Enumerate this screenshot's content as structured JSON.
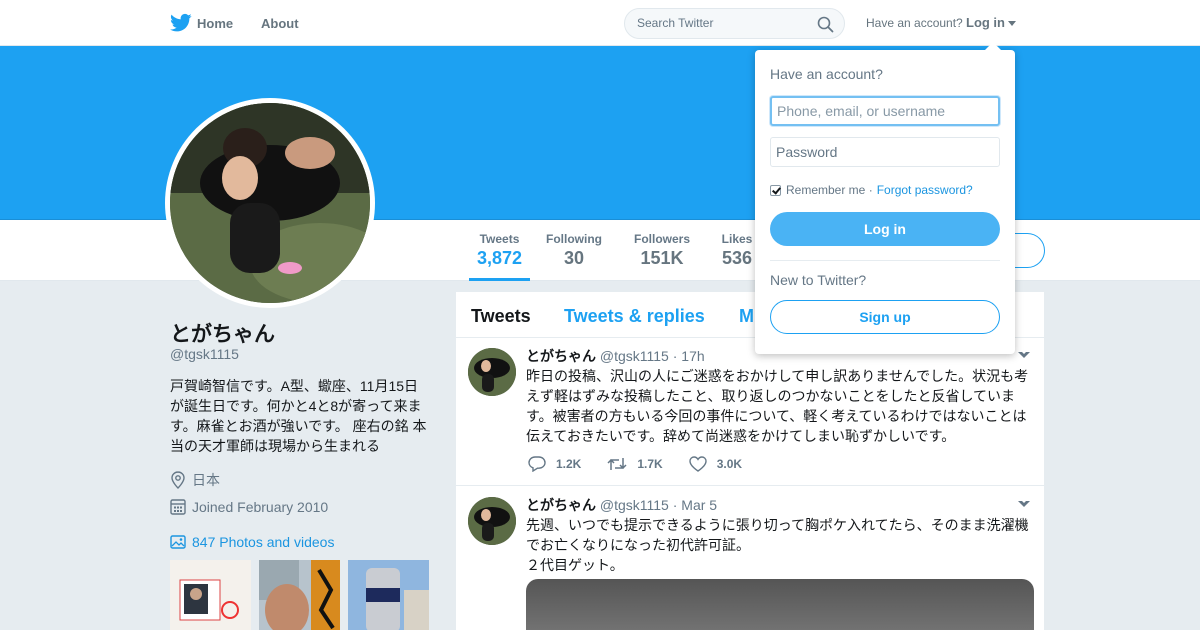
{
  "nav": {
    "home_label": "Home",
    "about_label": "About",
    "search_placeholder": "Search Twitter",
    "have_account": "Have an account?",
    "login_label": "Log in",
    "brand_color": "#1da1f2"
  },
  "stats": [
    {
      "label": "Tweets",
      "value": "3,872"
    },
    {
      "label": "Following",
      "value": "30"
    },
    {
      "label": "Followers",
      "value": "151K"
    },
    {
      "label": "Likes",
      "value": "536"
    }
  ],
  "profile": {
    "name": "とがちゃん",
    "handle": "@tgsk1115",
    "bio": "戸賀崎智信です。A型、蠍座、11月15日が誕生日です。何かと4と8が寄って来ます。麻雀とお酒が強いです。 座右の銘 本当の天才軍師は現場から生まれる",
    "location": "日本",
    "joined": "Joined February 2010",
    "photos_link": "847 Photos and videos"
  },
  "timeline": {
    "tabs": [
      "Tweets",
      "Tweets & replies",
      "M"
    ]
  },
  "tweets": [
    {
      "name": "とがちゃん",
      "meta": "@tgsk1115 · 17h",
      "text": "昨日の投稿、沢山の人にご迷惑をおかけして申し訳ありませんでした。状況も考えず軽はずみな投稿したこと、取り返しのつかないことをしたと反省しています。被害者の方もいる今回の事件について、軽く考えているわけではないことは伝えておきたいです。辞めて尚迷惑をかけてしまい恥ずかしいです。",
      "replies": "1.2K",
      "retweets": "1.7K",
      "likes": "3.0K"
    },
    {
      "name": "とがちゃん",
      "meta": "@tgsk1115 · Mar 5",
      "text": "先週、いつでも提示できるように張り切って胸ポケ入れてたら、そのまま洗濯機でお亡くなりになった初代許可証。\n２代目ゲット。"
    }
  ],
  "login_dropdown": {
    "title": "Have an account?",
    "username_placeholder": "Phone, email, or username",
    "password_placeholder": "Password",
    "remember_label": "Remember me ·",
    "forgot_label": "Forgot password?",
    "login_button": "Log in",
    "new_label": "New to Twitter?",
    "signup_button": "Sign up"
  }
}
